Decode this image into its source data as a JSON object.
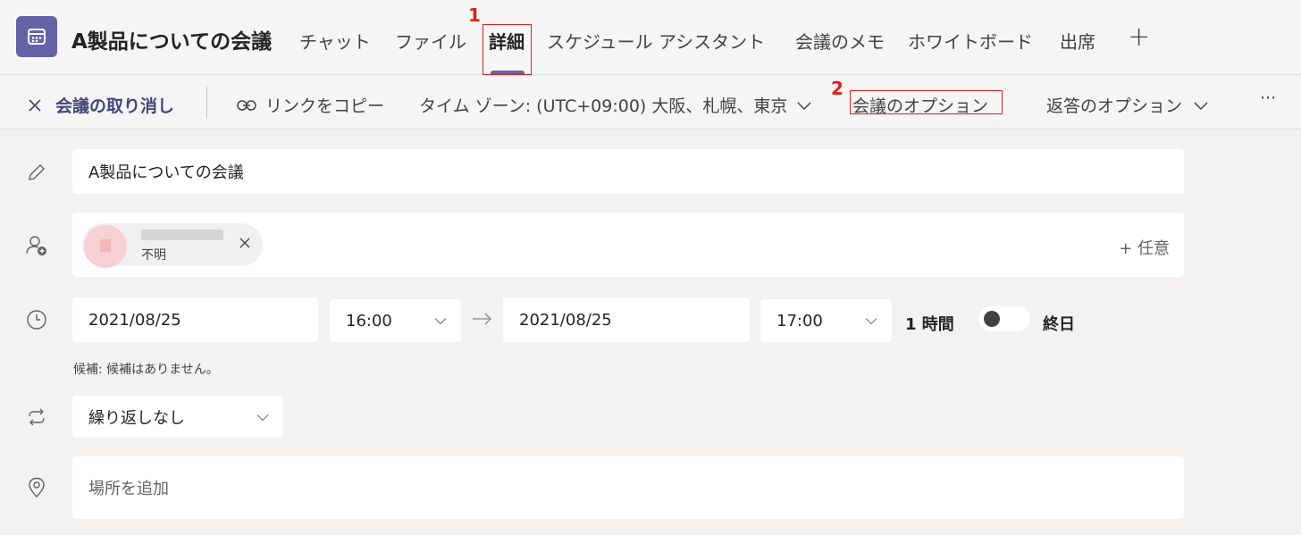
{
  "header": {
    "title": "A製品についての会議",
    "tabs": [
      {
        "label": "チャット",
        "active": false
      },
      {
        "label": "ファイル",
        "active": false
      },
      {
        "label": "詳細",
        "active": true
      },
      {
        "label": "スケジュール アシスタント",
        "active": false
      },
      {
        "label": "会議のメモ",
        "active": false
      },
      {
        "label": "ホワイトボード",
        "active": false
      },
      {
        "label": "出席",
        "active": false
      }
    ],
    "add_tab_glyph": "+"
  },
  "annotations": [
    {
      "number": "1",
      "target": "詳細"
    },
    {
      "number": "2",
      "target": "会議のオプション"
    }
  ],
  "toolbar": {
    "cancel_label": "会議の取り消し",
    "copy_link_label": "リンクをコピー",
    "timezone_label": "タイム ゾーン: (UTC+09:00) 大阪、札幌、東京",
    "meeting_options_label": "会議のオプション",
    "response_options_label": "返答のオプション",
    "more_glyph": "···"
  },
  "form": {
    "title_value": "A製品についての会議",
    "attendee": {
      "status": "不明"
    },
    "optional_label": "+ 任意",
    "start_date": "2021/08/25",
    "start_time": "16:00",
    "end_date": "2021/08/25",
    "end_time": "17:00",
    "duration": "1 時間",
    "all_day_label": "終日",
    "all_day_enabled": false,
    "suggestion_text": "候補: 候補はありません。",
    "repeat_value": "繰り返しなし",
    "location_placeholder": "場所を追加"
  },
  "colors": {
    "accent": "#6264a7",
    "annotation_red": "#e0201b",
    "background": "#f3f2f1",
    "field_bg": "#ffffff"
  },
  "icons": {
    "app": "calendar-icon",
    "title_row": "pencil-icon",
    "attendee_row": "add-person-icon",
    "time_row": "clock-icon",
    "repeat_row": "repeat-icon",
    "location_row": "location-icon"
  }
}
